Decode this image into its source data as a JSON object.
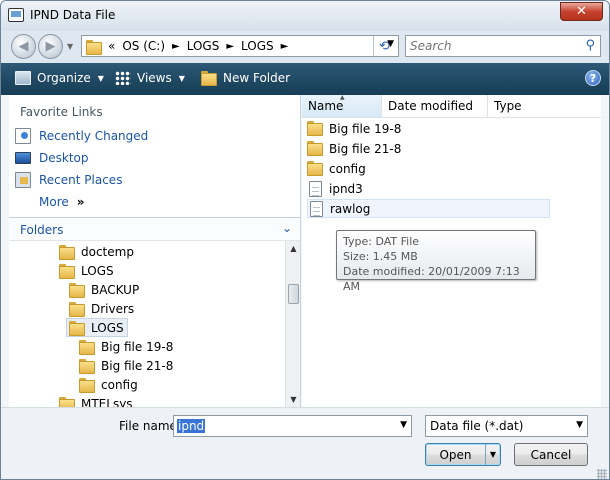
{
  "window": {
    "title": "IPND Data File",
    "close_label": "✕"
  },
  "address": {
    "overflow": "«",
    "parts": [
      "OS (C:)",
      "LOGS",
      "LOGS"
    ],
    "separator": "►"
  },
  "search": {
    "placeholder": "Search"
  },
  "toolbar": {
    "organize_label": "Organize",
    "views_label": "Views",
    "new_folder_label": "New Folder",
    "help_label": "?"
  },
  "favorites": {
    "title": "Favorite Links",
    "items": [
      {
        "label": "Recently Changed",
        "icon": "recently-changed-icon"
      },
      {
        "label": "Desktop",
        "icon": "desktop-icon"
      },
      {
        "label": "Recent Places",
        "icon": "recent-places-icon"
      }
    ],
    "more_label": "More",
    "more_arrows": "»"
  },
  "folders": {
    "title": "Folders",
    "tree": [
      {
        "label": "doctemp",
        "depth": 0
      },
      {
        "label": "LOGS",
        "depth": 0
      },
      {
        "label": "BACKUP",
        "depth": 1
      },
      {
        "label": "Drivers",
        "depth": 1
      },
      {
        "label": "LOGS",
        "depth": 1,
        "selected": true
      },
      {
        "label": "Big file 19-8",
        "depth": 2
      },
      {
        "label": "Big file 21-8",
        "depth": 2
      },
      {
        "label": "config",
        "depth": 2
      },
      {
        "label": "MTELsys",
        "depth": 0
      }
    ]
  },
  "file_list": {
    "columns": [
      "Name",
      "Date modified",
      "Type"
    ],
    "sorted_column": "Name",
    "items": [
      {
        "name": "Big file 19-8",
        "kind": "folder"
      },
      {
        "name": "Big file 21-8",
        "kind": "folder"
      },
      {
        "name": "config",
        "kind": "folder"
      },
      {
        "name": "ipnd3",
        "kind": "file"
      },
      {
        "name": "rawlog",
        "kind": "file",
        "hover": true
      }
    ]
  },
  "tooltip": {
    "type_line": "Type: DAT File",
    "size_line": "Size: 1.45 MB",
    "date_line": "Date modified: 20/01/2009 7:13 AM"
  },
  "bottom": {
    "file_name_label": "File name:",
    "file_name_value": "ipnd",
    "file_type": "Data file (*.dat)",
    "open_label": "Open",
    "cancel_label": "Cancel"
  },
  "colors": {
    "toolbar": "#1f4862",
    "link": "#1b55a8",
    "selection": "#3875d7",
    "close": "#c7432f"
  }
}
